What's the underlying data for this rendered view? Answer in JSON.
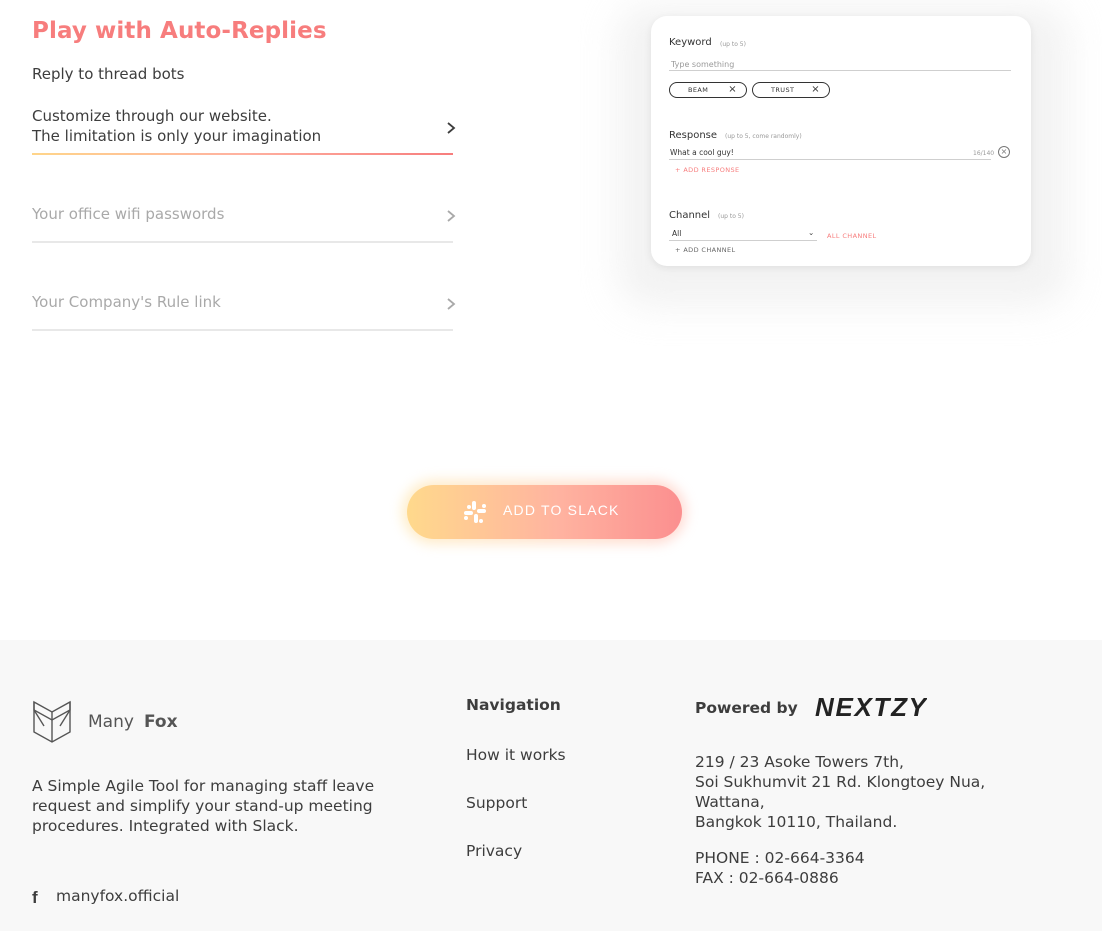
{
  "section": {
    "title": "Play with Auto-Replies",
    "subtitle": "Reply to thread bots"
  },
  "features": [
    {
      "lines": [
        "Customize through our website.",
        "The limitation is only your imagination"
      ],
      "state": "active"
    },
    {
      "lines": [
        "Your office wifi passwords"
      ],
      "state": "inactive"
    },
    {
      "lines": [
        "Your Company's Rule link"
      ],
      "state": "inactive"
    }
  ],
  "preview": {
    "keyword_label": "Keyword",
    "keyword_hint": "(up to 5)",
    "keyword_placeholder": "Type something",
    "tags": [
      "BEAM",
      "TRUST"
    ],
    "response_label": "Response",
    "response_hint": "(up to 5, come randomly)",
    "response_value": "What a cool guy!",
    "response_count": "16/140",
    "add_response": "ADD RESPONSE",
    "channel_label": "Channel",
    "channel_hint": "(up to 5)",
    "channel_value": "All",
    "all_channel": "ALL CHANNEL",
    "add_channel": "ADD CHANNEL"
  },
  "cta": {
    "label": "ADD TO SLACK",
    "icon": "slack-icon"
  },
  "footer": {
    "logo": {
      "many": "Many",
      "fox": "Fox"
    },
    "tagline": "A Simple Agile Tool for managing staff leave request and simplify your stand-up meeting procedures. Integrated with Slack.",
    "social": {
      "icon": "facebook-icon",
      "handle": "manyfox.official"
    },
    "nav_title": "Navigation",
    "nav_links": [
      "How it works",
      "Support",
      "Privacy"
    ],
    "powered_by": "Powered by",
    "partner_logo": "NEXTZY",
    "address": [
      "219 / 23 Asoke Towers 7th,",
      "Soi Sukhumvit 21 Rd. Klongtoey Nua,",
      "Wattana,",
      "Bangkok 10110, Thailand."
    ],
    "phone": "PHONE : 02-664-3364",
    "fax": "FAX : 02-664-0886"
  },
  "colors": {
    "accent": "#f77d7d",
    "gradient_start": "#ffd98c",
    "gradient_end": "#fb8f8f",
    "footer_bg": "#f8f8f8"
  }
}
